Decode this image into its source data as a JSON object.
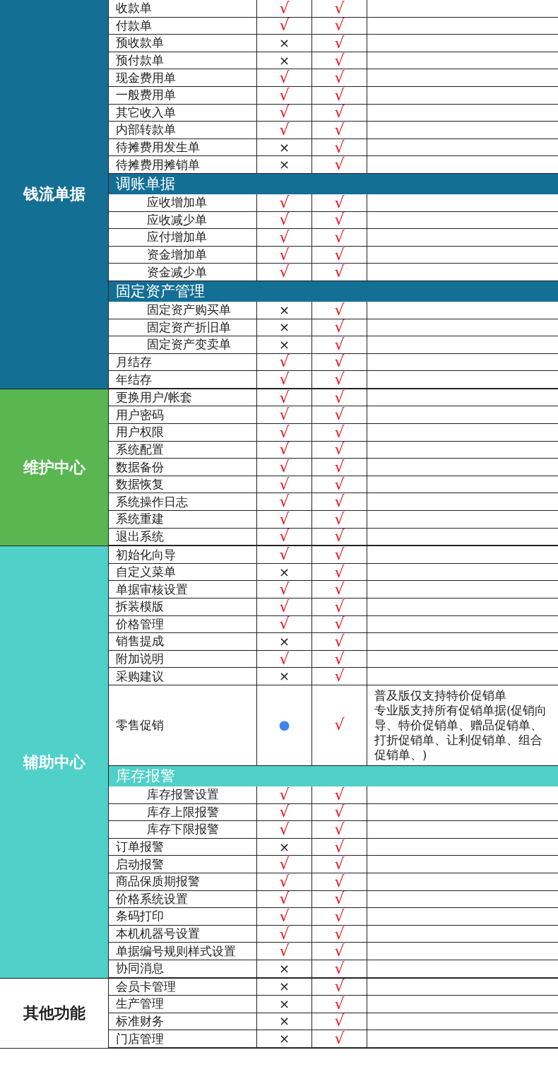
{
  "groups": [
    {
      "category": "钱流单据",
      "color": "#146f94",
      "rows": [
        {
          "kind": "item",
          "name": "收款单",
          "basic": "√",
          "pro": "√"
        },
        {
          "kind": "item",
          "name": "付款单",
          "basic": "√",
          "pro": "√"
        },
        {
          "kind": "item",
          "name": "预收款单",
          "basic": "×",
          "pro": "√"
        },
        {
          "kind": "item",
          "name": "预付款单",
          "basic": "×",
          "pro": "√"
        },
        {
          "kind": "item",
          "name": "现金费用单",
          "basic": "√",
          "pro": "√"
        },
        {
          "kind": "item",
          "name": "一般费用单",
          "basic": "√",
          "pro": "√"
        },
        {
          "kind": "item",
          "name": "其它收入单",
          "basic": "√",
          "pro": "√"
        },
        {
          "kind": "item",
          "name": "内部转款单",
          "basic": "√",
          "pro": "√"
        },
        {
          "kind": "item",
          "name": "待摊费用发生单",
          "basic": "×",
          "pro": "√"
        },
        {
          "kind": "item",
          "name": "待摊费用摊销单",
          "basic": "×",
          "pro": "√"
        },
        {
          "kind": "subheader",
          "name": "调账单据",
          "children": [
            {
              "kind": "item",
              "name": "应收增加单",
              "basic": "√",
              "pro": "√"
            },
            {
              "kind": "item",
              "name": "应收减少单",
              "basic": "√",
              "pro": "√"
            },
            {
              "kind": "item",
              "name": "应付增加单",
              "basic": "√",
              "pro": "√"
            },
            {
              "kind": "item",
              "name": "资金增加单",
              "basic": "√",
              "pro": "√"
            },
            {
              "kind": "item",
              "name": "资金减少单",
              "basic": "√",
              "pro": "√"
            }
          ]
        },
        {
          "kind": "subheader",
          "name": "固定资产管理",
          "children": [
            {
              "kind": "item",
              "name": "固定资产购买单",
              "basic": "×",
              "pro": "√"
            },
            {
              "kind": "item",
              "name": "固定资产折旧单",
              "basic": "×",
              "pro": "√"
            },
            {
              "kind": "item",
              "name": "固定资产变卖单",
              "basic": "×",
              "pro": "√"
            }
          ]
        },
        {
          "kind": "item",
          "name": "月结存",
          "basic": "√",
          "pro": "√"
        },
        {
          "kind": "item",
          "name": "年结存",
          "basic": "√",
          "pro": "√"
        }
      ]
    },
    {
      "category": "维护中心",
      "color": "#5ab651",
      "rows": [
        {
          "kind": "item",
          "name": "更换用户/帐套",
          "basic": "√",
          "pro": "√"
        },
        {
          "kind": "item",
          "name": "用户密码",
          "basic": "√",
          "pro": "√"
        },
        {
          "kind": "item",
          "name": "用户权限",
          "basic": "√",
          "pro": "√"
        },
        {
          "kind": "item",
          "name": "系统配置",
          "basic": "√",
          "pro": "√"
        },
        {
          "kind": "item",
          "name": "数据备份",
          "basic": "√",
          "pro": "√"
        },
        {
          "kind": "item",
          "name": "数据恢复",
          "basic": "√",
          "pro": "√"
        },
        {
          "kind": "item",
          "name": "系统操作日志",
          "basic": "√",
          "pro": "√"
        },
        {
          "kind": "item",
          "name": "系统重建",
          "basic": "√",
          "pro": "√"
        },
        {
          "kind": "item",
          "name": "退出系统",
          "basic": "√",
          "pro": "√"
        }
      ]
    },
    {
      "category": "辅助中心",
      "color": "#4fd0c8",
      "rows": [
        {
          "kind": "item",
          "name": "初始化向导",
          "basic": "√",
          "pro": "√"
        },
        {
          "kind": "item",
          "name": "自定义菜单",
          "basic": "×",
          "pro": "√"
        },
        {
          "kind": "item",
          "name": "单据审核设置",
          "basic": "√",
          "pro": "√"
        },
        {
          "kind": "item",
          "name": "拆装模版",
          "basic": "√",
          "pro": "√"
        },
        {
          "kind": "item",
          "name": "价格管理",
          "basic": "√",
          "pro": "√"
        },
        {
          "kind": "item",
          "name": "销售提成",
          "basic": "×",
          "pro": "√"
        },
        {
          "kind": "item",
          "name": "附加说明",
          "basic": "√",
          "pro": "√"
        },
        {
          "kind": "item",
          "name": "采购建议",
          "basic": "×",
          "pro": "√"
        },
        {
          "kind": "item",
          "name": "零售促销",
          "basic": "●",
          "pro": "√",
          "notes": [
            "普及版仅支持特价促销单",
            "专业版支持所有促销单据(促销向导、特价促销单、赠品促销单、打折促销单、让利促销单、组合促销单、)"
          ]
        },
        {
          "kind": "subheader",
          "name": "库存报警",
          "children": [
            {
              "kind": "item",
              "name": "库存报警设置",
              "basic": "√",
              "pro": "√"
            },
            {
              "kind": "item",
              "name": "库存上限报警",
              "basic": "√",
              "pro": "√"
            },
            {
              "kind": "item",
              "name": "库存下限报警",
              "basic": "√",
              "pro": "√"
            }
          ]
        },
        {
          "kind": "item",
          "name": "订单报警",
          "basic": "×",
          "pro": "√"
        },
        {
          "kind": "item",
          "name": "启动报警",
          "basic": "√",
          "pro": "√"
        },
        {
          "kind": "item",
          "name": "商品保质期报警",
          "basic": "√",
          "pro": "√"
        },
        {
          "kind": "item",
          "name": "价格系统设置",
          "basic": "√",
          "pro": "√"
        },
        {
          "kind": "item",
          "name": "条码打印",
          "basic": "√",
          "pro": "√"
        },
        {
          "kind": "item",
          "name": "本机机器号设置",
          "basic": "√",
          "pro": "√"
        },
        {
          "kind": "item",
          "name": "单据编号规则样式设置",
          "basic": "√",
          "pro": "√"
        },
        {
          "kind": "item",
          "name": "协同消息",
          "basic": "×",
          "pro": "√"
        }
      ]
    },
    {
      "category": "其他功能",
      "color": "#ffffff",
      "rows": [
        {
          "kind": "item",
          "name": "会员卡管理",
          "basic": "×",
          "pro": "√"
        },
        {
          "kind": "item",
          "name": "生产管理",
          "basic": "×",
          "pro": "√"
        },
        {
          "kind": "item",
          "name": "标准财务",
          "basic": "×",
          "pro": "√"
        },
        {
          "kind": "item",
          "name": "门店管理",
          "basic": "×",
          "pro": "√"
        }
      ]
    }
  ]
}
